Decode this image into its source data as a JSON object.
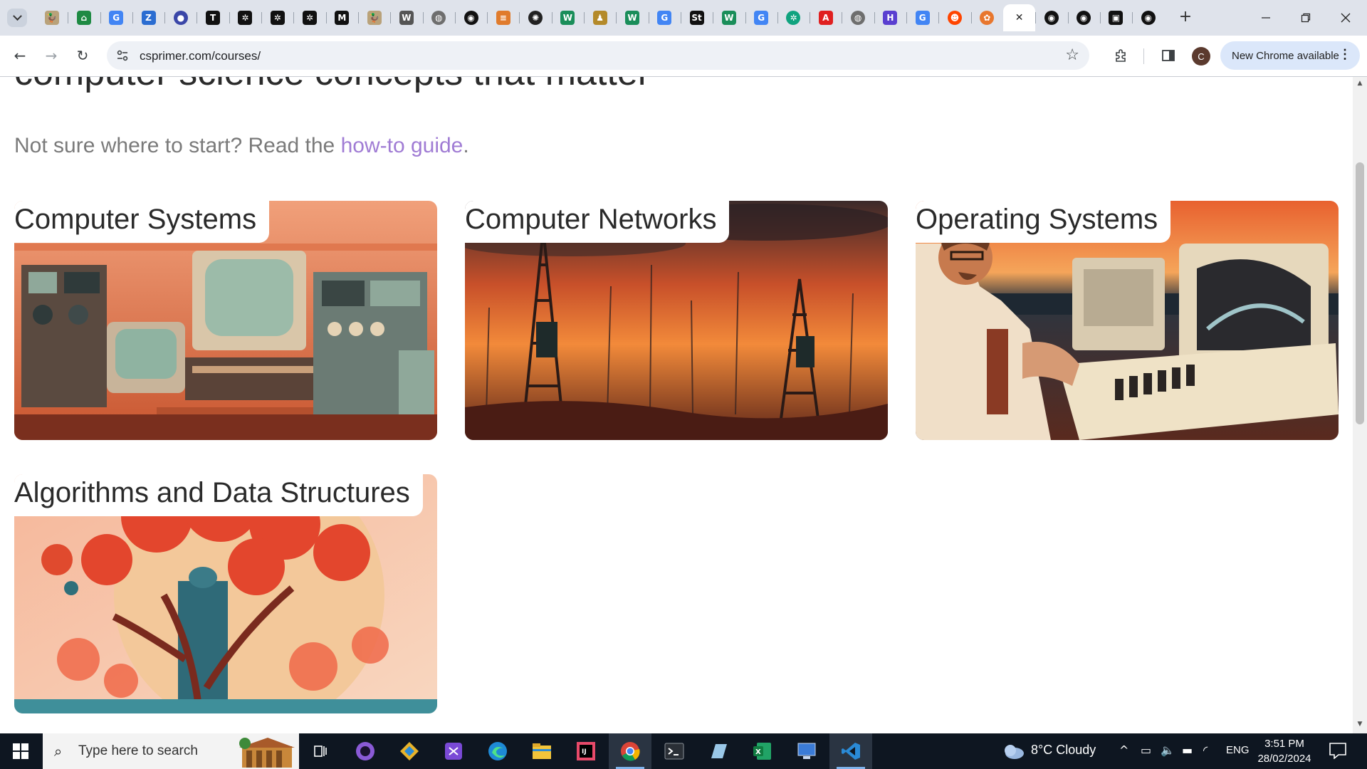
{
  "browser": {
    "tabs": [
      {
        "icon": "duck-icon",
        "color": "#b9a27a",
        "glyph": "🦆"
      },
      {
        "icon": "house-icon",
        "color": "#1e8a43",
        "glyph": "⌂"
      },
      {
        "icon": "google-icon",
        "color": "#4285f4",
        "glyph": "G"
      },
      {
        "icon": "zotero-icon",
        "color": "#2b6dd1",
        "glyph": "Z"
      },
      {
        "icon": "circle-icon",
        "color": "#3b47a8",
        "glyph": "●"
      },
      {
        "icon": "t-icon",
        "color": "#111111",
        "glyph": "T"
      },
      {
        "icon": "openai-icon",
        "color": "#111111",
        "glyph": "✲"
      },
      {
        "icon": "openai-icon",
        "color": "#111111",
        "glyph": "✲"
      },
      {
        "icon": "openai-icon",
        "color": "#111111",
        "glyph": "✲"
      },
      {
        "icon": "medium-icon",
        "color": "#111111",
        "glyph": "M"
      },
      {
        "icon": "duck-icon",
        "color": "#b9a27a",
        "glyph": "🦆"
      },
      {
        "icon": "wikipedia-icon",
        "color": "#555555",
        "glyph": "W"
      },
      {
        "icon": "globe-icon",
        "color": "#6e6e6e",
        "glyph": "◍"
      },
      {
        "icon": "github-icon",
        "color": "#111111",
        "glyph": "◉"
      },
      {
        "icon": "stack-icon",
        "color": "#e07b2c",
        "glyph": "≡"
      },
      {
        "icon": "wolfram-icon",
        "color": "#222222",
        "glyph": "✺"
      },
      {
        "icon": "w-icon",
        "color": "#1a8e5a",
        "glyph": "W"
      },
      {
        "icon": "bell-icon",
        "color": "#b48a2a",
        "glyph": "♟"
      },
      {
        "icon": "w-icon",
        "color": "#1a8e5a",
        "glyph": "W"
      },
      {
        "icon": "google-icon",
        "color": "#4285f4",
        "glyph": "G"
      },
      {
        "icon": "st-icon",
        "color": "#111111",
        "glyph": "St"
      },
      {
        "icon": "w-icon",
        "color": "#1a8e5a",
        "glyph": "W"
      },
      {
        "icon": "google-icon",
        "color": "#4285f4",
        "glyph": "G"
      },
      {
        "icon": "chatgpt-icon",
        "color": "#10a37f",
        "glyph": "✲"
      },
      {
        "icon": "acrobat-icon",
        "color": "#e02020",
        "glyph": "A"
      },
      {
        "icon": "globe-icon",
        "color": "#6e6e6e",
        "glyph": "◍"
      },
      {
        "icon": "grid-icon",
        "color": "#5a3fd0",
        "glyph": "H"
      },
      {
        "icon": "google-icon",
        "color": "#4285f4",
        "glyph": "G"
      },
      {
        "icon": "reddit-icon",
        "color": "#ff4500",
        "glyph": "☻"
      },
      {
        "icon": "firefox-icon",
        "color": "#e8772e",
        "glyph": "✿"
      },
      {
        "icon": "close-icon",
        "color": "#ffffff",
        "glyph": "✕",
        "active": true
      },
      {
        "icon": "github-icon",
        "color": "#111111",
        "glyph": "◉"
      },
      {
        "icon": "github-icon",
        "color": "#111111",
        "glyph": "◉"
      },
      {
        "icon": "media-icon",
        "color": "#111111",
        "glyph": "▣"
      },
      {
        "icon": "github-icon",
        "color": "#111111",
        "glyph": "◉"
      }
    ],
    "url": "csprimer.com/courses/",
    "avatar_letter": "C",
    "update_label": "New Chrome available"
  },
  "page": {
    "heading": "computer science concepts that matter",
    "intro_text": "Not sure where to start? Read the ",
    "intro_link": "how-to guide",
    "intro_end": ".",
    "courses": [
      {
        "title": "Computer Systems",
        "art": "systems"
      },
      {
        "title": "Computer Networks",
        "art": "networks"
      },
      {
        "title": "Operating Systems",
        "art": "os"
      },
      {
        "title": "Algorithms and Data Structures",
        "art": "algorithms"
      }
    ]
  },
  "taskbar": {
    "search_placeholder": "Type here to search",
    "weather": "8°C  Cloudy",
    "language": "ENG",
    "time": "3:51 PM",
    "date": "28/02/2024"
  }
}
